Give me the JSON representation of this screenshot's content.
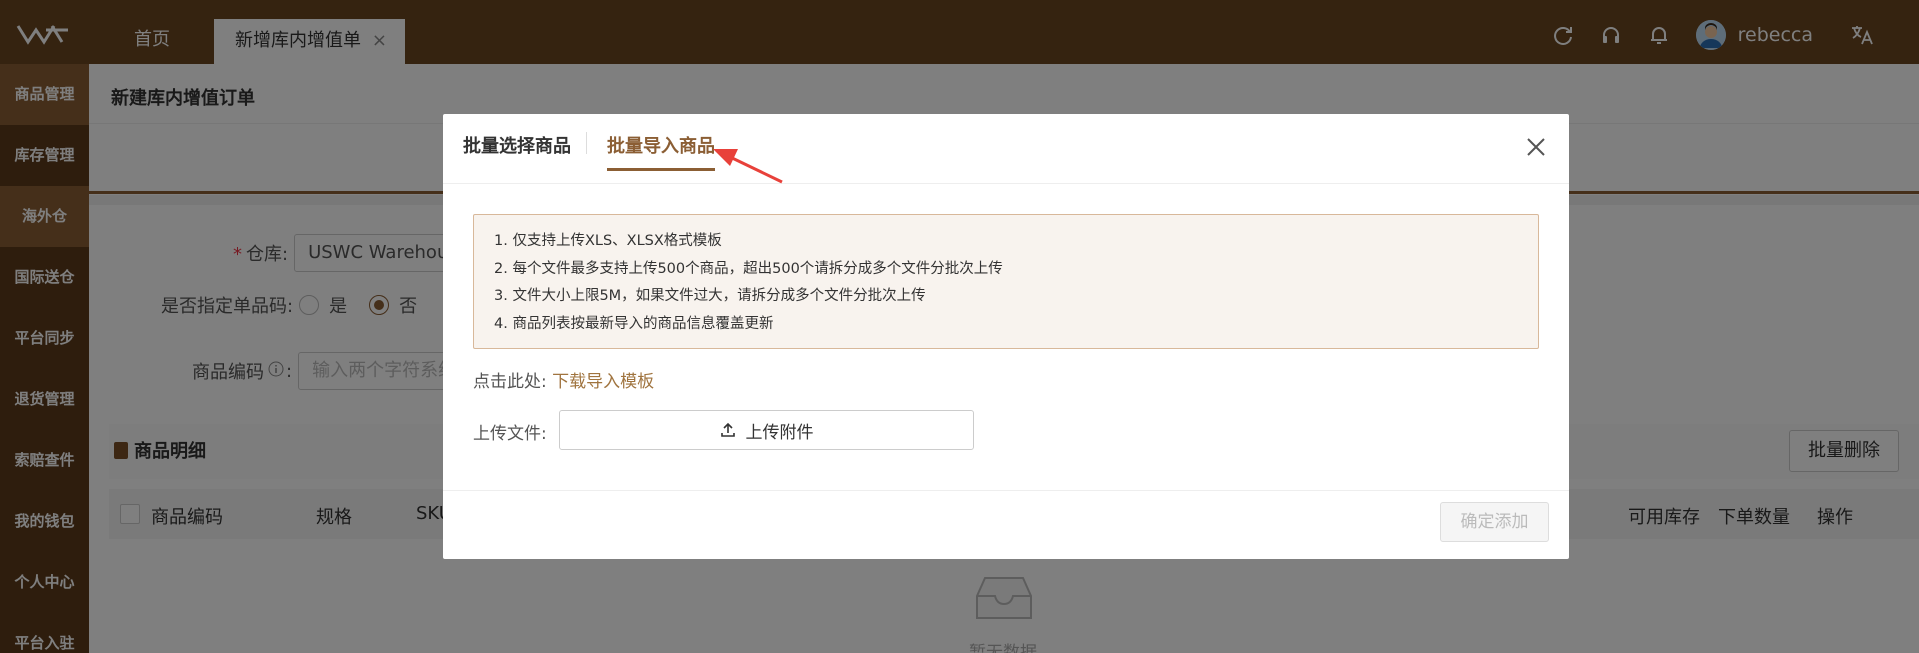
{
  "topbar": {
    "tabs": [
      {
        "label": "首页"
      },
      {
        "label": "新增库内增值单",
        "close": "×"
      }
    ],
    "username": "rebecca"
  },
  "sidebar": {
    "items": [
      {
        "label": "商品管理"
      },
      {
        "label": "库存管理"
      },
      {
        "label": "海外仓",
        "active": true
      },
      {
        "label": "国际送仓"
      },
      {
        "label": "平台同步"
      },
      {
        "label": "退货管理"
      },
      {
        "label": "索赔查件"
      },
      {
        "label": "我的钱包"
      },
      {
        "label": "个人中心"
      },
      {
        "label": "平台入驻"
      }
    ]
  },
  "page": {
    "title": "新建库内增值订单",
    "warehouse": {
      "label": "仓库:",
      "value": "USWC Warehouse"
    },
    "single_code": {
      "label": "是否指定单品码:",
      "yes": "是",
      "no": "否",
      "selected": "否"
    },
    "product_code": {
      "label": "商品编码",
      "placeholder": "输入两个字符系统"
    },
    "section_title": "商品明细",
    "batch_delete": "批量删除",
    "table_headers": [
      "商品编码",
      "规格",
      "SKU",
      "可用库存",
      "下单数量",
      "操作"
    ],
    "empty_text": "暂无数据"
  },
  "modal": {
    "tabs": [
      {
        "label": "批量选择商品"
      },
      {
        "label": "批量导入商品",
        "active": true
      }
    ],
    "notice": [
      "1. 仅支持上传XLS、XLSX格式模板",
      "2. 每个文件最多支持上传500个商品，超出500个请拆分成多个文件分批次上传",
      "3. 文件大小上限5M，如果文件过大，请拆分成多个文件分批次上传",
      "4. 商品列表按最新导入的商品信息覆盖更新"
    ],
    "download_prefix": "点击此处:",
    "download_link": "下载导入模板",
    "upload_label": "上传文件:",
    "upload_button": "上传附件",
    "confirm_button": "确定添加"
  },
  "colors": {
    "brand": "#6b4621",
    "accent": "#8b5e34",
    "link": "#a0743f",
    "annotation_arrow": "#e8413a"
  }
}
